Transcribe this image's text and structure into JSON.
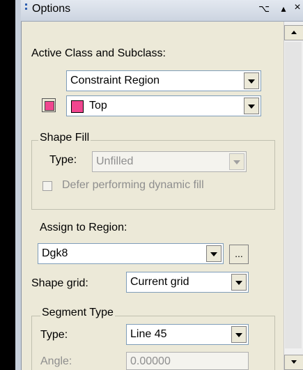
{
  "window": {
    "title": "Options",
    "pin_glyph": "⌥",
    "collapse_glyph": "▴",
    "close_glyph": "×"
  },
  "active_class": {
    "label": "Active Class and Subclass:",
    "class_value": "Constraint Region",
    "subclass_value": "Top",
    "subclass_color": "#f0468f"
  },
  "shape_fill": {
    "legend": "Shape Fill",
    "type_label": "Type:",
    "type_value": "Unfilled",
    "defer_label": "Defer performing dynamic fill"
  },
  "region": {
    "assign_label": "Assign to Region:",
    "region_value": "Dgk8",
    "browse_label": "...",
    "grid_label": "Shape grid:",
    "grid_value": "Current grid"
  },
  "segment": {
    "legend": "Segment Type",
    "type_label": "Type:",
    "type_value": "Line 45",
    "angle_label": "Angle:",
    "angle_value": "0.00000"
  }
}
